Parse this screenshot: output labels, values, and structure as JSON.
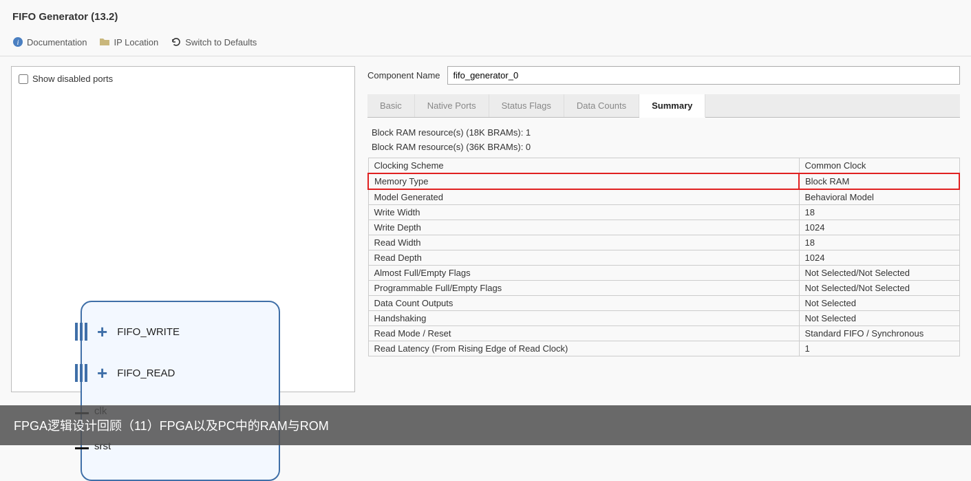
{
  "header": {
    "title": "FIFO Generator (13.2)"
  },
  "toolbar": {
    "documentation": "Documentation",
    "ip_location": "IP Location",
    "switch_defaults": "Switch to Defaults"
  },
  "left": {
    "show_disabled_label": "Show disabled ports",
    "ports": {
      "fifo_write": "FIFO_WRITE",
      "fifo_read": "FIFO_READ",
      "clk": "clk",
      "srst": "srst"
    }
  },
  "right": {
    "component_name_label": "Component Name",
    "component_name_value": "fifo_generator_0",
    "tabs": [
      "Basic",
      "Native Ports",
      "Status Flags",
      "Data Counts",
      "Summary"
    ],
    "active_tab": "Summary",
    "bram_18k": "Block RAM resource(s) (18K BRAMs): 1",
    "bram_36k": "Block RAM resource(s) (36K BRAMs): 0",
    "rows": [
      {
        "k": "Clocking Scheme",
        "v": "Common Clock",
        "hl": false
      },
      {
        "k": "Memory Type",
        "v": "Block RAM",
        "hl": true
      },
      {
        "k": "Model Generated",
        "v": "Behavioral Model",
        "hl": false
      },
      {
        "k": "Write Width",
        "v": "18",
        "hl": false
      },
      {
        "k": "Write Depth",
        "v": "1024",
        "hl": false
      },
      {
        "k": "Read Width",
        "v": "18",
        "hl": false
      },
      {
        "k": "Read Depth",
        "v": "1024",
        "hl": false
      },
      {
        "k": "Almost Full/Empty Flags",
        "v": "Not Selected/Not Selected",
        "hl": false
      },
      {
        "k": "Programmable Full/Empty Flags",
        "v": "Not Selected/Not Selected",
        "hl": false
      },
      {
        "k": "Data Count Outputs",
        "v": "Not Selected",
        "hl": false
      },
      {
        "k": "Handshaking",
        "v": "Not Selected",
        "hl": false
      },
      {
        "k": "Read Mode / Reset",
        "v": "Standard FIFO / Synchronous",
        "hl": false
      },
      {
        "k": "Read Latency (From Rising Edge of Read Clock)",
        "v": "1",
        "hl": false
      }
    ]
  },
  "footer": {
    "caption": "FPGA逻辑设计回顾（11）FPGA以及PC中的RAM与ROM"
  }
}
